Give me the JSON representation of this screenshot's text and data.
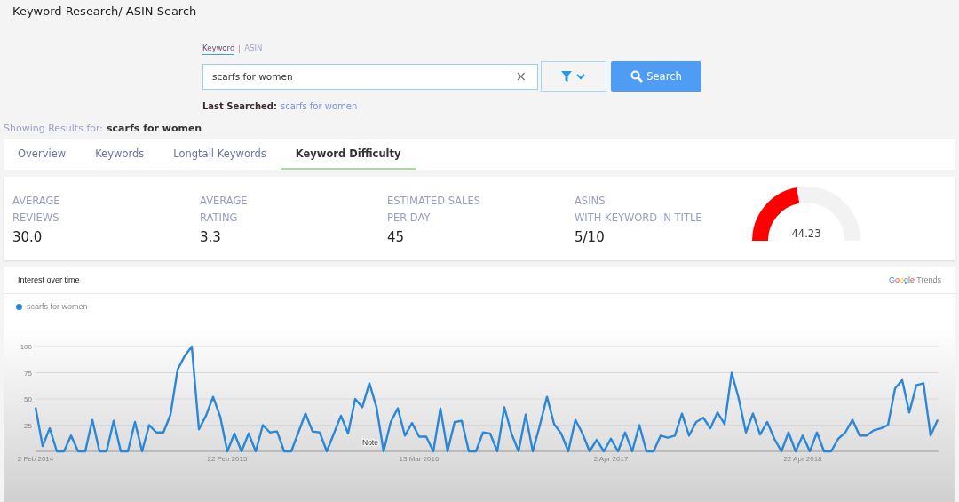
{
  "page_title": "Keyword Research/ ASIN Search",
  "search_modes": [
    {
      "label": "Keyword",
      "selected": true
    },
    {
      "label": "ASIN",
      "selected": false
    }
  ],
  "search": {
    "value": "scarfs for women",
    "clear": "×",
    "button": "Search"
  },
  "last_searched": {
    "label": "Last Searched:",
    "value": "scarfs for women"
  },
  "results_for": {
    "label": "Showing Results for:",
    "value": "scarfs for women"
  },
  "tabs": [
    {
      "label": "Overview",
      "selected": false
    },
    {
      "label": "Keywords",
      "selected": false
    },
    {
      "label": "Longtail Keywords",
      "selected": false
    },
    {
      "label": "Keyword Difficulty",
      "selected": true
    }
  ],
  "stats": [
    {
      "label": [
        "AVERAGE",
        "REVIEWS"
      ],
      "value": "30.0"
    },
    {
      "label": [
        "AVERAGE",
        "RATING"
      ],
      "value": "3.3"
    },
    {
      "label": [
        "ESTIMATED SALES",
        "PER DAY"
      ],
      "value": "45"
    },
    {
      "label": [
        "ASINS",
        "WITH KEYWORD IN TITLE"
      ],
      "value": "5/10"
    }
  ],
  "gauge": {
    "level": 0.4423,
    "reading": "44.23"
  },
  "trends": {
    "title": "Interest over time",
    "logo": "Google",
    "logo_suffix": "Trends",
    "note": "Note",
    "chart_data": {
      "type": "line",
      "grid": true,
      "categories": [
        "2 Feb 2014",
        null,
        null,
        null,
        null,
        null,
        null,
        null,
        null,
        null,
        null,
        null,
        null,
        null,
        null,
        null,
        null,
        null,
        null,
        null,
        null,
        null,
        null,
        null,
        null,
        null,
        null,
        "22 Feb 2015",
        null,
        null,
        null,
        null,
        null,
        null,
        null,
        null,
        null,
        null,
        null,
        null,
        null,
        null,
        null,
        null,
        null,
        null,
        null,
        null,
        null,
        null,
        null,
        null,
        null,
        null,
        "13 Mar 2016",
        null,
        null,
        null,
        null,
        null,
        null,
        null,
        null,
        null,
        null,
        null,
        null,
        null,
        null,
        null,
        null,
        null,
        null,
        null,
        null,
        null,
        null,
        null,
        null,
        null,
        null,
        "2 Apr 2017",
        null,
        null,
        null,
        null,
        null,
        null,
        null,
        null,
        null,
        null,
        null,
        null,
        null,
        null,
        null,
        null,
        null,
        null,
        null,
        null,
        null,
        null,
        null,
        null,
        null,
        null,
        "22 Apr 2018",
        null,
        null,
        null,
        null,
        null,
        null,
        null,
        null,
        null,
        null,
        null,
        null,
        null,
        null,
        null,
        null,
        null,
        null,
        null
      ],
      "yticks": [
        25,
        50,
        75,
        100
      ],
      "ylim": [
        0,
        100
      ],
      "series": [
        {
          "name": "scarfs for women",
          "color": "#2b87d8",
          "values": [
            42,
            5,
            22,
            0,
            0,
            15,
            0,
            0,
            30,
            0,
            0,
            29,
            0,
            0,
            28,
            0,
            25,
            18,
            18,
            35,
            78,
            91,
            100,
            21,
            34,
            52,
            33,
            0,
            17,
            0,
            17,
            0,
            25,
            18,
            19,
            0,
            0,
            18,
            36,
            19,
            18,
            0,
            17,
            34,
            17,
            50,
            42,
            65,
            42,
            0,
            28,
            41,
            15,
            27,
            14,
            14,
            0,
            41,
            0,
            28,
            29,
            0,
            0,
            18,
            17,
            0,
            42,
            17,
            0,
            35,
            0,
            25,
            52,
            26,
            17,
            0,
            30,
            17,
            0,
            11,
            0,
            12,
            0,
            18,
            0,
            25,
            0,
            0,
            15,
            13,
            15,
            36,
            15,
            28,
            32,
            22,
            37,
            26,
            75,
            50,
            18,
            36,
            16,
            28,
            12,
            0,
            18,
            0,
            15,
            0,
            18,
            0,
            0,
            12,
            18,
            30,
            15,
            15,
            20,
            22,
            25,
            60,
            68,
            37,
            63,
            65,
            15,
            30
          ]
        }
      ]
    }
  }
}
